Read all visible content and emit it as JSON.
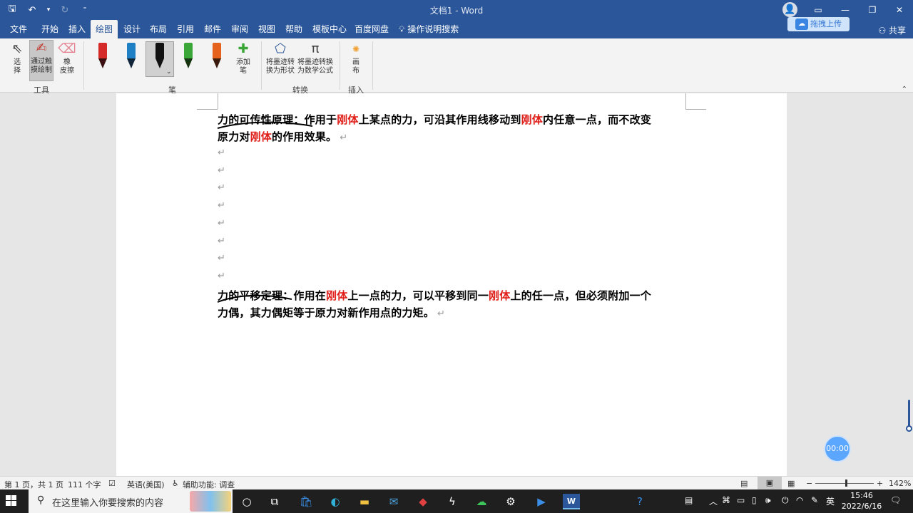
{
  "window": {
    "title": "文档1 - Word",
    "controls": [
      "ribbon-display",
      "minimize",
      "restore",
      "close"
    ]
  },
  "qat": {
    "items": [
      "save-icon",
      "undo-icon",
      "redo-icon",
      "customize-icon"
    ]
  },
  "cloud": {
    "upload_label": "拖拽上传"
  },
  "tabs": [
    {
      "label": "文件"
    },
    {
      "label": "开始"
    },
    {
      "label": "插入"
    },
    {
      "label": "绘图",
      "active": true
    },
    {
      "label": "设计"
    },
    {
      "label": "布局"
    },
    {
      "label": "引用"
    },
    {
      "label": "邮件"
    },
    {
      "label": "审阅"
    },
    {
      "label": "视图"
    },
    {
      "label": "帮助"
    },
    {
      "label": "模板中心"
    },
    {
      "label": "百度网盘"
    },
    {
      "label": "操作说明搜索"
    }
  ],
  "share": {
    "label": "共享"
  },
  "ribbon": {
    "tools": {
      "label": "工具",
      "select": "选\n择",
      "draw_touch": "通过触\n摸绘制",
      "eraser": "橡\n皮擦"
    },
    "pens": {
      "label": "笔",
      "colors": [
        "#d42a2a",
        "#1e7fc4",
        "#111111",
        "#3aa637",
        "#e5621c"
      ],
      "add_pen": "添加\n笔"
    },
    "convert": {
      "label": "转换",
      "to_shape": "将墨迹转\n换为形状",
      "to_math": "将墨迹转换\n为数学公式"
    },
    "insert": {
      "label": "插入",
      "canvas": "画\n布"
    }
  },
  "document": {
    "para1": {
      "term": "力的可传性原理",
      "line1": [
        {
          "t": "力的可传性原理：作用于"
        },
        {
          "t": "刚体",
          "red": true
        },
        {
          "t": "上某点的力，可沿其作用线移动到"
        },
        {
          "t": "刚体",
          "red": true
        },
        {
          "t": "内任意一点，而不改变"
        }
      ],
      "line2": [
        {
          "t": "原力对"
        },
        {
          "t": "刚体",
          "red": true
        },
        {
          "t": "的作用效果。"
        }
      ]
    },
    "empty_paragraphs": 8,
    "para2": {
      "term": "力的平移定理",
      "line1": [
        {
          "t": "力的平移定理：作用在"
        },
        {
          "t": "刚体",
          "red": true
        },
        {
          "t": "上一点的力，可以平移到同一"
        },
        {
          "t": "刚体",
          "red": true
        },
        {
          "t": "上的任一点，但必须附加一个"
        }
      ],
      "line2": [
        {
          "t": "力偶，其力偶矩等于原力对新作用点的力矩。"
        }
      ]
    },
    "paragraph_mark": "↵"
  },
  "timer": {
    "label": "00:00"
  },
  "status": {
    "page": "第 1 页，共 1 页",
    "words": "111 个字",
    "language": "英语(美国)",
    "accessibility": "辅助功能: 调查",
    "zoom": "142%",
    "zoom_fraction": 0.52
  },
  "taskbar": {
    "search_placeholder": "在这里输入你要搜索的内容",
    "ime": "英",
    "time": "15:46",
    "date": "2022/6/16"
  }
}
